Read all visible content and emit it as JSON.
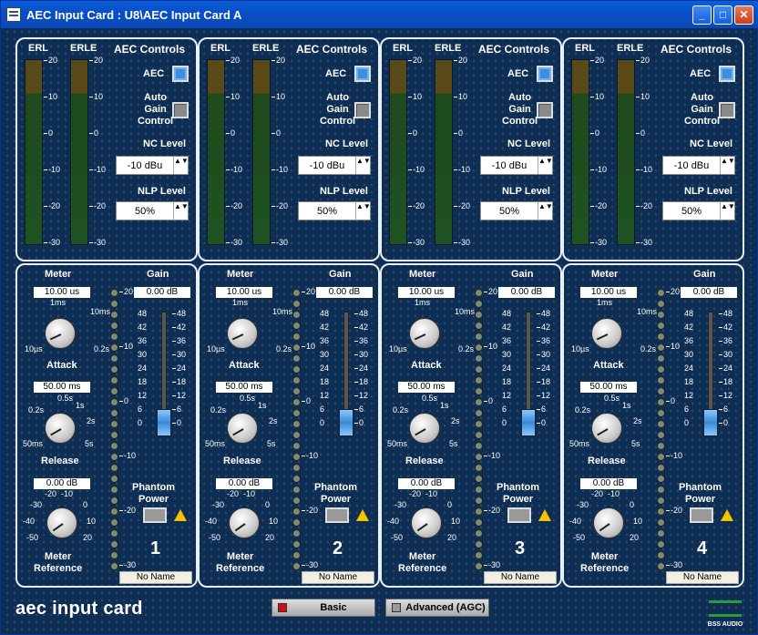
{
  "window": {
    "title": "AEC Input Card : U8\\AEC Input Card A",
    "min": "_",
    "max": "□",
    "close": "✕"
  },
  "aec": {
    "erl": "ERL",
    "erle": "ERLE",
    "controls_title": "AEC Controls",
    "aec_label": "AEC",
    "agc_label": "Auto\nGain\nControl",
    "nc_label": "NC Level",
    "nlp_label": "NLP Level",
    "meter_scale": [
      "20",
      "10",
      "0",
      "-10",
      "-20",
      "-30"
    ]
  },
  "strip": {
    "meter_label": "Meter",
    "gain_label": "Gain",
    "attack_label": "Attack",
    "release_label": "Release",
    "meterref_label": "Meter\nReference",
    "phantom_label": "Phantom\nPower",
    "attack_ticks": [
      "1ms",
      "10ms",
      "10µs",
      "0.2s"
    ],
    "release_ticks": [
      "0.5s",
      "1s",
      "0.2s",
      "2s",
      "50ms",
      "5s"
    ],
    "ref_ticks": [
      "-20",
      "-10",
      "-30",
      "0",
      "-40",
      "10",
      "-50",
      "20"
    ],
    "ledscale": [
      "20",
      "10",
      "0",
      "-10",
      "-20",
      "-30"
    ],
    "fader_scale": [
      "48",
      "42",
      "36",
      "30",
      "24",
      "18",
      "12",
      "6",
      "0"
    ]
  },
  "channels": [
    {
      "num": "1",
      "nc": "-10 dBu",
      "nlp": "50%",
      "meter": "10.00 us",
      "gain": "0.00 dB",
      "release": "50.00 ms",
      "ref": "0.00 dB",
      "name": "No Name",
      "aec_on": true
    },
    {
      "num": "2",
      "nc": "-10 dBu",
      "nlp": "50%",
      "meter": "10.00 us",
      "gain": "0.00 dB",
      "release": "50.00 ms",
      "ref": "0.00 dB",
      "name": "No Name",
      "aec_on": true
    },
    {
      "num": "3",
      "nc": "-10 dBu",
      "nlp": "50%",
      "meter": "10.00 us",
      "gain": "0.00 dB",
      "release": "50.00 ms",
      "ref": "0.00 dB",
      "name": "No Name",
      "aec_on": true
    },
    {
      "num": "4",
      "nc": "-10 dBu",
      "nlp": "50%",
      "meter": "10.00 us",
      "gain": "0.00 dB",
      "release": "50.00 ms",
      "ref": "0.00 dB",
      "name": "No Name",
      "aec_on": true
    }
  ],
  "footer": {
    "title": "aec input card",
    "basic": "Basic",
    "advanced": "Advanced (AGC)",
    "logo": "BSS AUDIO"
  },
  "colors": {
    "background": "#0e2e54",
    "aec_on": "#3b8fe0",
    "basic_indicator": "#d01010"
  }
}
